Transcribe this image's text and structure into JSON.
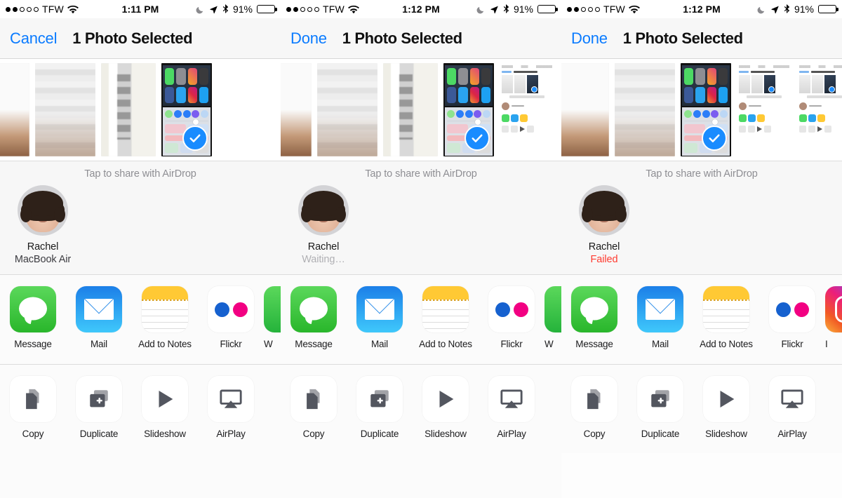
{
  "panels": [
    {
      "status": {
        "carrier": "TFW",
        "signal_filled": 2,
        "signal_total": 5,
        "time": "1:11 PM",
        "battery_percent": "91%",
        "icons": [
          "wifi-icon",
          "moon-icon",
          "location-arrow-icon",
          "bluetooth-icon",
          "battery-icon"
        ]
      },
      "nav": {
        "action": "Cancel",
        "title": "1 Photo Selected"
      },
      "airdrop": {
        "hint": "Tap to share with AirDrop",
        "name": "Rachel",
        "status": "MacBook Air",
        "state": "device"
      },
      "apps": [
        {
          "label": "Message",
          "icon": "message-icon"
        },
        {
          "label": "Mail",
          "icon": "mail-icon"
        },
        {
          "label": "Add to Notes",
          "icon": "notes-icon"
        },
        {
          "label": "Flickr",
          "icon": "flickr-icon"
        },
        {
          "label": "W",
          "icon": "whatsapp-icon"
        }
      ],
      "actions": [
        {
          "label": "Copy",
          "icon": "copy-icon"
        },
        {
          "label": "Duplicate",
          "icon": "duplicate-icon"
        },
        {
          "label": "Slideshow",
          "icon": "slideshow-icon"
        },
        {
          "label": "AirPlay",
          "icon": "airplay-icon"
        }
      ],
      "thumbnails": [
        "photo-partial",
        "photo-document",
        "photo-document-2",
        "screenshot-selected"
      ]
    },
    {
      "status": {
        "carrier": "TFW",
        "signal_filled": 2,
        "signal_total": 5,
        "time": "1:12 PM",
        "battery_percent": "91%",
        "icons": [
          "wifi-icon",
          "moon-icon",
          "location-arrow-icon",
          "bluetooth-icon",
          "battery-icon"
        ]
      },
      "nav": {
        "action": "Done",
        "title": "1 Photo Selected"
      },
      "airdrop": {
        "hint": "Tap to share with AirDrop",
        "name": "Rachel",
        "status": "Waiting…",
        "state": "waiting"
      },
      "apps": [
        {
          "label": "Message",
          "icon": "message-icon"
        },
        {
          "label": "Mail",
          "icon": "mail-icon"
        },
        {
          "label": "Add to Notes",
          "icon": "notes-icon"
        },
        {
          "label": "Flickr",
          "icon": "flickr-icon"
        },
        {
          "label": "W",
          "icon": "whatsapp-icon"
        }
      ],
      "actions": [
        {
          "label": "Copy",
          "icon": "copy-icon"
        },
        {
          "label": "Duplicate",
          "icon": "duplicate-icon"
        },
        {
          "label": "Slideshow",
          "icon": "slideshow-icon"
        },
        {
          "label": "AirPlay",
          "icon": "airplay-icon"
        }
      ],
      "thumbnails": [
        "photo-partial",
        "photo-document",
        "photo-document-2",
        "screenshot-selected",
        "screenshot-sharesheet"
      ]
    },
    {
      "status": {
        "carrier": "TFW",
        "signal_filled": 2,
        "signal_total": 5,
        "time": "1:12 PM",
        "battery_percent": "91%",
        "icons": [
          "wifi-icon",
          "moon-icon",
          "location-arrow-icon",
          "bluetooth-icon",
          "battery-icon"
        ]
      },
      "nav": {
        "action": "Done",
        "title": "1 Photo Selected"
      },
      "airdrop": {
        "hint": "Tap to share with AirDrop",
        "name": "Rachel",
        "status": "Failed",
        "state": "failed"
      },
      "apps": [
        {
          "label": "Message",
          "icon": "message-icon"
        },
        {
          "label": "Mail",
          "icon": "mail-icon"
        },
        {
          "label": "Add to Notes",
          "icon": "notes-icon"
        },
        {
          "label": "Flickr",
          "icon": "flickr-icon"
        },
        {
          "label": "I",
          "icon": "instagram-icon"
        }
      ],
      "actions": [
        {
          "label": "Copy",
          "icon": "copy-icon"
        },
        {
          "label": "Duplicate",
          "icon": "duplicate-icon"
        },
        {
          "label": "Slideshow",
          "icon": "slideshow-icon"
        },
        {
          "label": "AirPlay",
          "icon": "airplay-icon"
        }
      ],
      "thumbnails": [
        "photo-document",
        "photo-document-2",
        "screenshot-selected",
        "screenshot-sharesheet",
        "screenshot-sharesheet-2"
      ]
    }
  ],
  "colors": {
    "accent_blue": "#0a7bff",
    "selection_blue": "#1a8cff",
    "failed_red": "#ff3b30",
    "waiting_gray": "#b0b0b4",
    "hint_gray": "#8e8e93",
    "bg": "#fbfbfb",
    "flickr_blue": "#1661CF",
    "flickr_pink": "#F20082"
  }
}
